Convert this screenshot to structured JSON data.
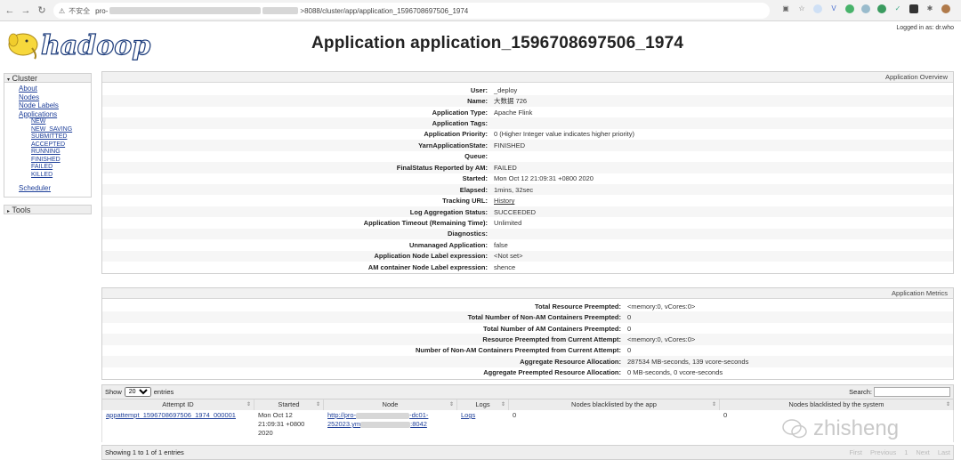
{
  "browser": {
    "security_label": "不安全",
    "url_prefix": "pro-",
    "url_suffix": ">8088/cluster/app/application_1596708697506_1974"
  },
  "header": {
    "logo_text": "hadoop",
    "title": "Application application_1596708697506_1974",
    "logged_in": "Logged in as: dr.who"
  },
  "sidebar": {
    "cluster_label": "Cluster",
    "links": [
      "About",
      "Nodes",
      "Node Labels",
      "Applications"
    ],
    "app_states": [
      "NEW",
      "NEW_SAVING",
      "SUBMITTED",
      "ACCEPTED",
      "RUNNING",
      "FINISHED",
      "FAILED",
      "KILLED"
    ],
    "scheduler_label": "Scheduler",
    "tools_label": "Tools"
  },
  "overview": {
    "heading": "Application Overview",
    "rows": [
      {
        "k": "User:",
        "v": "_deploy"
      },
      {
        "k": "Name:",
        "v": "大数据 726"
      },
      {
        "k": "Application Type:",
        "v": "Apache Flink"
      },
      {
        "k": "Application Tags:",
        "v": ""
      },
      {
        "k": "Application Priority:",
        "v": "0 (Higher Integer value indicates higher priority)"
      },
      {
        "k": "YarnApplicationState:",
        "v": "FINISHED"
      },
      {
        "k": "Queue:",
        "v": ""
      },
      {
        "k": "FinalStatus Reported by AM:",
        "v": "FAILED"
      },
      {
        "k": "Started:",
        "v": "Mon Oct 12 21:09:31 +0800 2020"
      },
      {
        "k": "Elapsed:",
        "v": "1mins, 32sec"
      },
      {
        "k": "Tracking URL:",
        "v": "History"
      },
      {
        "k": "Log Aggregation Status:",
        "v": "SUCCEEDED"
      },
      {
        "k": "Application Timeout (Remaining Time):",
        "v": "Unlimited"
      },
      {
        "k": "Diagnostics:",
        "v": ""
      },
      {
        "k": "Unmanaged Application:",
        "v": "false"
      },
      {
        "k": "Application Node Label expression:",
        "v": "<Not set>"
      },
      {
        "k": "AM container Node Label expression:",
        "v": "shence"
      }
    ]
  },
  "metrics": {
    "heading": "Application Metrics",
    "rows": [
      {
        "k": "Total Resource Preempted:",
        "v": "<memory:0, vCores:0>"
      },
      {
        "k": "Total Number of Non-AM Containers Preempted:",
        "v": "0"
      },
      {
        "k": "Total Number of AM Containers Preempted:",
        "v": "0"
      },
      {
        "k": "Resource Preempted from Current Attempt:",
        "v": "<memory:0, vCores:0>"
      },
      {
        "k": "Number of Non-AM Containers Preempted from Current Attempt:",
        "v": "0"
      },
      {
        "k": "Aggregate Resource Allocation:",
        "v": "287534 MB-seconds, 139 vcore-seconds"
      },
      {
        "k": "Aggregate Preempted Resource Allocation:",
        "v": "0 MB-seconds, 0 vcore-seconds"
      }
    ]
  },
  "attempts": {
    "show_label": "Show",
    "entries_label": "entries",
    "page_size": "20",
    "search_label": "Search:",
    "columns": [
      "Attempt ID",
      "Started",
      "Node",
      "Logs",
      "Nodes blacklisted by the app",
      "Nodes blacklisted by the system"
    ],
    "row": {
      "attempt_id": "appattempt_1596708697506_1974_000001",
      "started_line1": "Mon Oct 12",
      "started_line2": "21:09:31 +0800",
      "started_line3": "2020",
      "node_line1": "http://pro-",
      "node_line1b": "-dc01-",
      "node_line2": "252023.ym",
      "node_line2b": ":8042",
      "logs": "Logs",
      "blacklisted_app": "0",
      "blacklisted_system": "0"
    },
    "footer_info": "Showing 1 to 1 of 1 entries",
    "pager": [
      "First",
      "Previous",
      "1",
      "Next",
      "Last"
    ]
  },
  "watermark": {
    "text": "zhisheng"
  }
}
